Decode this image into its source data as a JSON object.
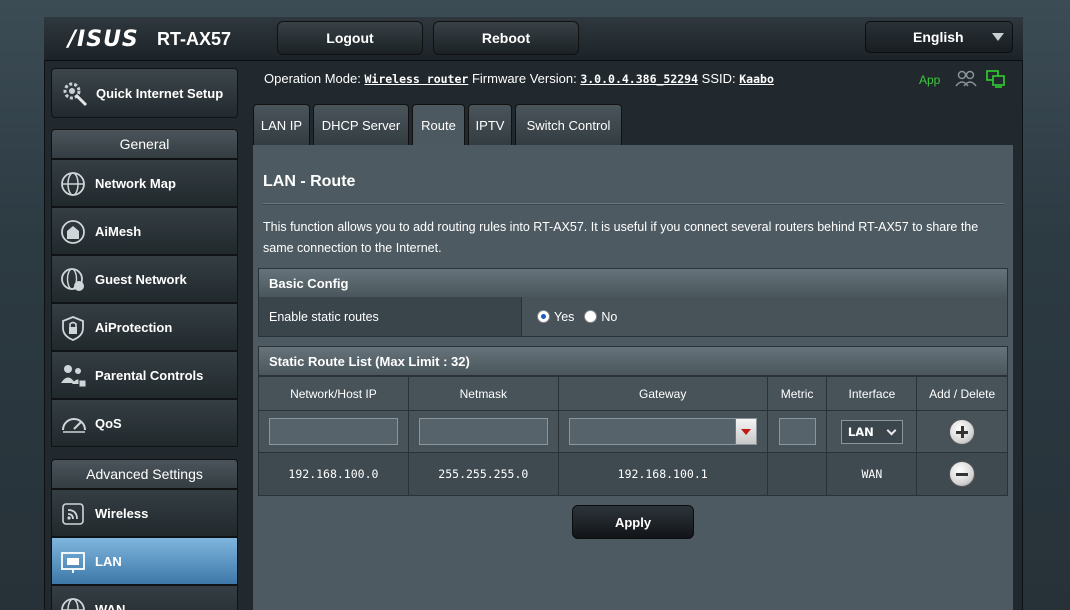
{
  "header": {
    "brand": "/ISUS",
    "model": "RT-AX57",
    "logout_label": "Logout",
    "reboot_label": "Reboot",
    "language": "English"
  },
  "info": {
    "op_mode_label": "Operation Mode:",
    "op_mode_value": "Wireless router",
    "firmware_label": "Firmware Version:",
    "firmware_value": "3.0.0.4.386_52294",
    "ssid_label": "SSID:",
    "ssid_value": "Kaabo",
    "app_label": "App"
  },
  "sidebar": {
    "quick_setup": "Quick Internet Setup",
    "general_header": "General",
    "general_items": [
      {
        "label": "Network Map",
        "icon": "globe-network-icon"
      },
      {
        "label": "AiMesh",
        "icon": "aimesh-icon"
      },
      {
        "label": "Guest Network",
        "icon": "guest-globe-icon"
      },
      {
        "label": "AiProtection",
        "icon": "lock-shield-icon"
      },
      {
        "label": "Parental Controls",
        "icon": "family-icon"
      },
      {
        "label": "QoS",
        "icon": "gauge-icon"
      }
    ],
    "advanced_header": "Advanced Settings",
    "advanced_items": [
      {
        "label": "Wireless",
        "icon": "wireless-icon"
      },
      {
        "label": "LAN",
        "icon": "lan-icon",
        "active": true
      },
      {
        "label": "WAN",
        "icon": "wan-globe-icon"
      }
    ]
  },
  "tabs": [
    {
      "label": "LAN IP"
    },
    {
      "label": "DHCP Server"
    },
    {
      "label": "Route",
      "active": true
    },
    {
      "label": "IPTV"
    },
    {
      "label": "Switch Control"
    }
  ],
  "page": {
    "title": "LAN - Route",
    "description": "This function allows you to add routing rules into RT-AX57. It is useful if you connect several routers behind RT-AX57 to share the same connection to the Internet.",
    "basic_config_header": "Basic Config",
    "static_routes_label": "Enable static routes",
    "yes_label": "Yes",
    "no_label": "No",
    "static_enabled": "Yes",
    "route_list_header": "Static Route List (Max Limit : 32)",
    "columns": [
      "Network/Host IP",
      "Netmask",
      "Gateway",
      "Metric",
      "Interface",
      "Add / Delete"
    ],
    "new_entry": {
      "network": "",
      "netmask": "",
      "gateway": "",
      "metric": "",
      "interface": "LAN"
    },
    "routes": [
      {
        "network": "192.168.100.0",
        "netmask": "255.255.255.0",
        "gateway": "192.168.100.1",
        "metric": "",
        "interface": "WAN"
      }
    ],
    "apply_label": "Apply"
  }
}
